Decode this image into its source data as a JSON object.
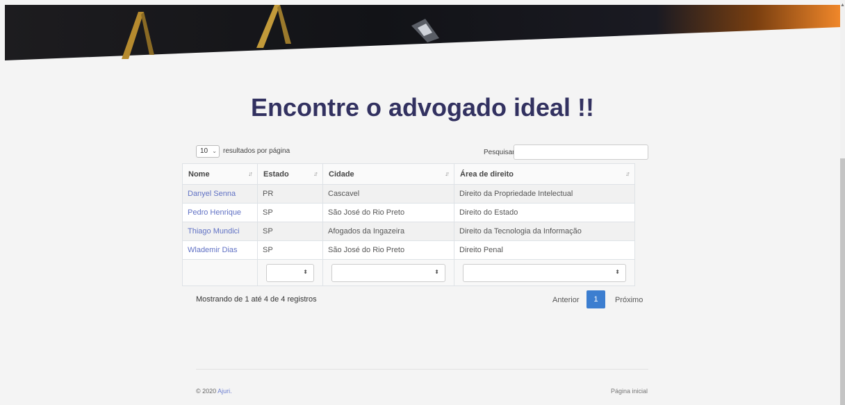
{
  "heading": "Encontre o advogado ideal !!",
  "length_menu": {
    "value": "10",
    "label": "resultados por página"
  },
  "search": {
    "label": "Pesquisar",
    "value": ""
  },
  "table": {
    "columns": [
      "Nome",
      "Estado",
      "Cidade",
      "Área de direito"
    ],
    "rows": [
      {
        "nome": "Danyel Senna",
        "estado": "PR",
        "cidade": "Cascavel",
        "area": "Direito da Propriedade Intelectual"
      },
      {
        "nome": "Pedro Henrique",
        "estado": "SP",
        "cidade": "São José do Rio Preto",
        "area": "Direito do Estado"
      },
      {
        "nome": "Thiago Mundici",
        "estado": "SP",
        "cidade": "Afogados da Ingazeira",
        "area": "Direito da Tecnologia da Informação"
      },
      {
        "nome": "Wlademir Dias",
        "estado": "SP",
        "cidade": "São José do Rio Preto",
        "area": "Direito Penal"
      }
    ],
    "filters": {
      "estado": "",
      "cidade": "",
      "area": ""
    }
  },
  "info": "Mostrando de 1 até 4 de 4 registros",
  "pagination": {
    "prev": "Anterior",
    "current": "1",
    "next": "Próximo"
  },
  "footer": {
    "copyright": "© 2020",
    "brand": "Ajuri.",
    "home_link": "Página inicial"
  },
  "colors": {
    "heading": "#323160",
    "link": "#6071c4",
    "page_active": "#3c7ed0"
  },
  "icons": {
    "sort": "sort-icon",
    "dropdown": "chevron-down-icon",
    "select": "up-down-icon"
  }
}
